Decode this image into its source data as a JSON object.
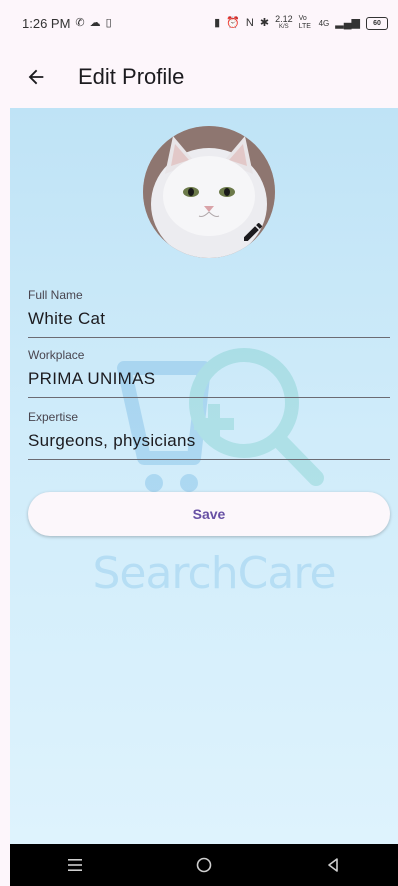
{
  "status_bar": {
    "time": "1:26 PM",
    "net_speed": "2.12",
    "net_unit": "K/S",
    "volte": "Vo LTE",
    "signal": "4G",
    "battery": "60"
  },
  "app_bar": {
    "title": "Edit Profile"
  },
  "profile": {
    "avatar_alt": "White Cat"
  },
  "fields": {
    "full_name": {
      "label": "Full Name",
      "value": "White Cat"
    },
    "workplace": {
      "label": "Workplace",
      "value": "PRIMA UNIMAS"
    },
    "expertise": {
      "label": "Expertise",
      "value": "Surgeons, physicians"
    }
  },
  "actions": {
    "save_label": "Save"
  },
  "watermark": {
    "text": "SearchCare"
  },
  "colors": {
    "primary": "#6750a4",
    "background_top": "#bfe3f6",
    "watermark": "#4aa6e0"
  }
}
